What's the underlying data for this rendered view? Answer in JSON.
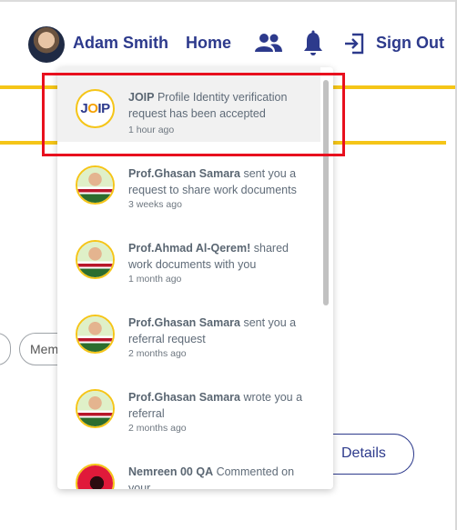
{
  "header": {
    "user_name": "Adam Smith",
    "home_label": "Home",
    "signout_label": "Sign Out",
    "icons": [
      "avatar",
      "people-icon",
      "bell-icon",
      "sign-out-icon"
    ]
  },
  "background": {
    "pill_label": "Mem",
    "details_label": "Details"
  },
  "notifications": [
    {
      "sender": "JOIP",
      "message": " Profile Identity verification request has been accepted",
      "time": "1 hour ago",
      "avatar": "joip-logo",
      "logo_text_left": "J",
      "logo_text_mid": "O",
      "logo_text_right": "IP"
    },
    {
      "sender": "Prof.Ghasan Samara",
      "message": " sent you a request to share work documents",
      "time": "3 weeks ago",
      "avatar": "person-photo"
    },
    {
      "sender": "Prof.Ahmad Al-Qerem!",
      "message": " shared work documents with you",
      "time": "1 month ago",
      "avatar": "person-photo"
    },
    {
      "sender": "Prof.Ghasan Samara",
      "message": " sent you a referral request",
      "time": "2 months ago",
      "avatar": "person-photo"
    },
    {
      "sender": "Prof.Ghasan Samara",
      "message": " wrote you a referral",
      "time": "2 months ago",
      "avatar": "person-photo"
    },
    {
      "sender": "Nemreen 00 QA",
      "message": " Commented on your",
      "time": "",
      "avatar": "red-logo"
    }
  ],
  "colors": {
    "brand_navy": "#2d3a8c",
    "accent_yellow": "#f5c518",
    "highlight_red": "#e8101e"
  }
}
